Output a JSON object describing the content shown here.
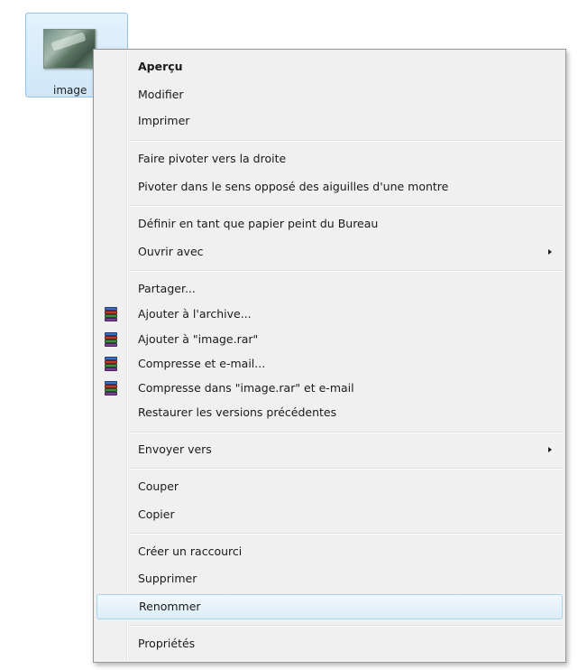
{
  "desktop_icon": {
    "label": "image"
  },
  "menu": {
    "items": [
      {
        "label": "Aperçu",
        "bold": true
      },
      {
        "label": "Modifier"
      },
      {
        "label": "Imprimer"
      },
      {
        "label": "Faire pivoter vers la droite"
      },
      {
        "label": "Pivoter dans le sens opposé des aiguilles d'une montre"
      },
      {
        "label": "Définir en tant que papier peint du Bureau"
      },
      {
        "label": "Ouvrir avec",
        "submenu": true
      },
      {
        "label": "Partager..."
      },
      {
        "label": "Ajouter à l'archive...",
        "icon": "winrar-icon"
      },
      {
        "label": "Ajouter à \"image.rar\"",
        "icon": "winrar-icon"
      },
      {
        "label": "Compresse et e-mail...",
        "icon": "winrar-icon"
      },
      {
        "label": "Compresse dans \"image.rar\" et e-mail",
        "icon": "winrar-icon"
      },
      {
        "label": "Restaurer les versions précédentes"
      },
      {
        "label": "Envoyer vers",
        "submenu": true
      },
      {
        "label": "Couper"
      },
      {
        "label": "Copier"
      },
      {
        "label": "Créer un raccourci"
      },
      {
        "label": "Supprimer"
      },
      {
        "label": "Renommer",
        "hovered": true
      },
      {
        "label": "Propriétés"
      }
    ]
  }
}
